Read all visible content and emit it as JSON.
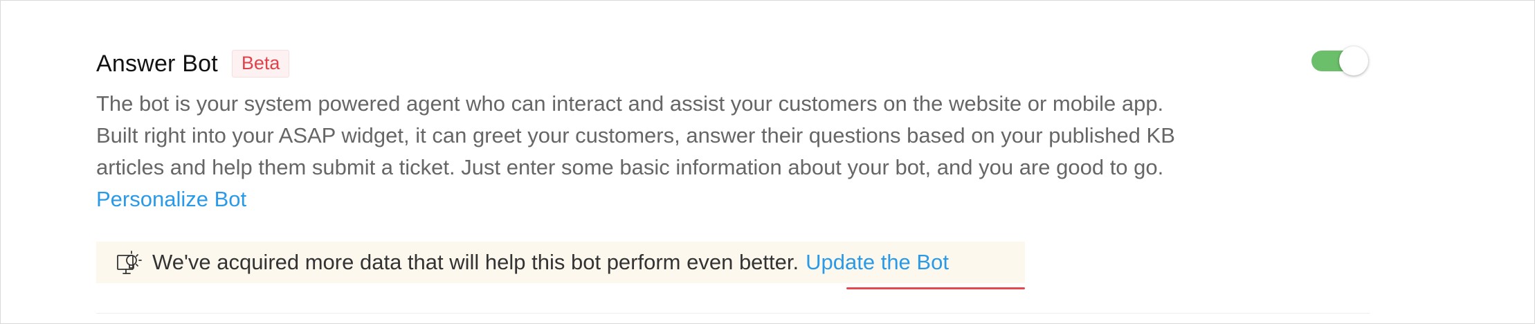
{
  "answer_bot": {
    "title": "Answer Bot",
    "badge": "Beta",
    "description": "The bot is your system powered agent who can interact and assist your customers on the website or mobile app. Built right into your ASAP widget, it can greet your customers, answer their questions based on your published KB articles and help them submit a ticket. Just enter some basic information about your bot, and you are good to go.",
    "personalize_link": "Personalize Bot",
    "toggle_on": true
  },
  "info_bar": {
    "icon": "lightbulb-icon",
    "message": "We've acquired more data that will help this bot perform even better.",
    "link_label": "Update the Bot"
  },
  "colors": {
    "toggle_on": "#6cbf6a",
    "link": "#2a9ae8",
    "badge_text": "#e0424b",
    "info_bg": "#fcf8ee",
    "underline": "#e5474f"
  }
}
